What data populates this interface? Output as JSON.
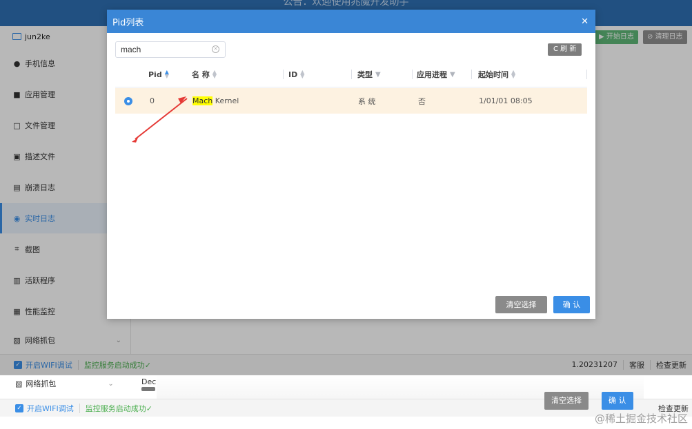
{
  "background": {
    "topbar_notice": "公告：欢迎使用兆魔开发助手",
    "user": "jun2ke",
    "sidebar": [
      {
        "label": "手机信息",
        "icon": "apple-icon"
      },
      {
        "label": "应用管理",
        "icon": "apps-grid-icon"
      },
      {
        "label": "文件管理",
        "icon": "folder-icon"
      },
      {
        "label": "描述文件",
        "icon": "profile-file-icon"
      },
      {
        "label": "崩溃日志",
        "icon": "crash-log-icon"
      },
      {
        "label": "实时日志",
        "icon": "realtime-log-icon",
        "active": true
      },
      {
        "label": "截图",
        "icon": "screenshot-icon"
      },
      {
        "label": "活跃程序",
        "icon": "active-apps-icon"
      },
      {
        "label": "性能监控",
        "icon": "performance-icon"
      },
      {
        "label": "网络抓包",
        "icon": "network-capture-icon"
      }
    ],
    "start_log": "开始日志",
    "clear_log": "清理日志",
    "status": {
      "wifi_debug": "开启WIFI调试",
      "monitor": "监控服务启动成功✓",
      "version": "1.20231207",
      "support": "客服",
      "check_update": "检查更新"
    },
    "second_copy": {
      "network": "网络抓包",
      "dec": "Dec",
      "wifi_debug": "开启WIFI调试",
      "monitor": "监控服务启动成功✓",
      "clear": "清空选择",
      "ok": "确 认",
      "check_update": "检查更新"
    },
    "watermark": "@稀土掘金技术社区"
  },
  "modal": {
    "title": "Pid列表",
    "search_value": "mach",
    "refresh": "C 刷 新",
    "columns": [
      "Pid",
      "名 称",
      "ID",
      "类型",
      "应用进程",
      "起始时间"
    ],
    "rows": [
      {
        "selected": true,
        "pid": "0",
        "name_highlight": "Mach",
        "name_rest": " Kernel",
        "id": "",
        "type": "系 统",
        "app_process": "否",
        "start_time": "1/01/01 08:05"
      }
    ],
    "clear_selection": "清空选择",
    "confirm": "确 认"
  },
  "colors": {
    "primary": "#3a8ee6",
    "header": "#3a86d6",
    "selected_row": "#fdf2e1",
    "highlight": "#ffff00",
    "annotation_arrow": "#e53935"
  }
}
